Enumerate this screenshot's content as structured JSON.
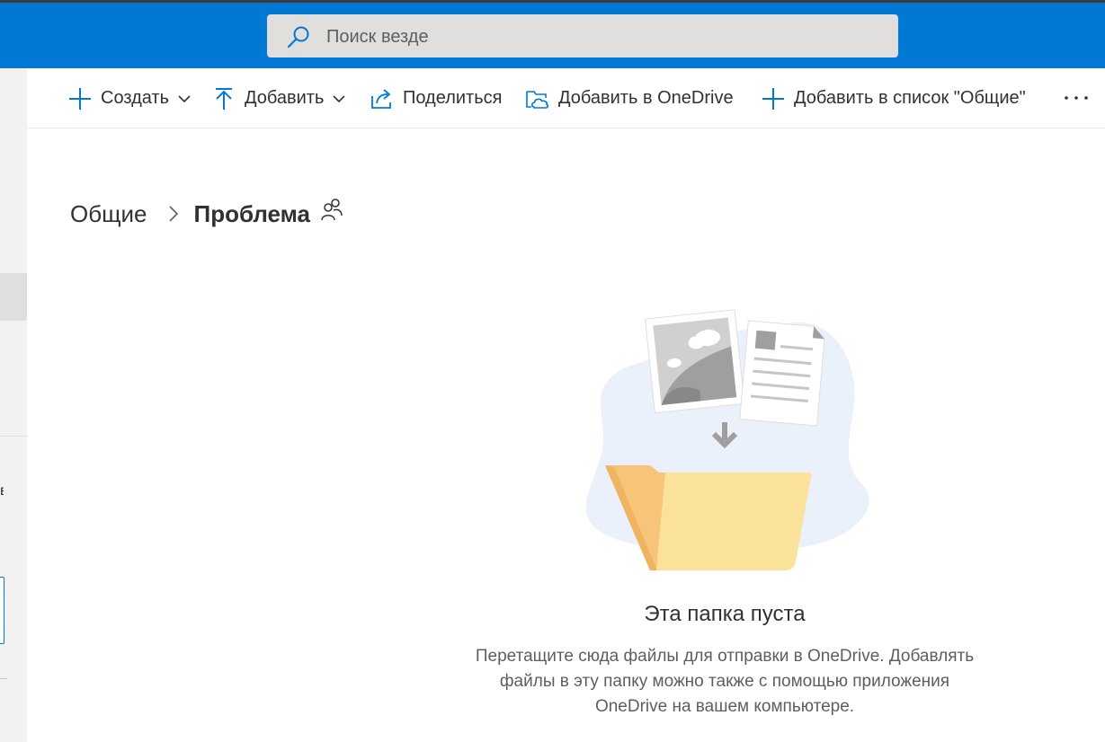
{
  "search": {
    "placeholder": "Поиск везде"
  },
  "toolbar": {
    "create_label": "Создать",
    "upload_label": "Добавить",
    "share_label": "Поделиться",
    "add_to_onedrive_label": "Добавить в OneDrive",
    "add_to_list_label": "Добавить в список \"Общие\""
  },
  "breadcrumb": {
    "root": "Общие",
    "current": "Проблема"
  },
  "empty_state": {
    "title": "Эта папка пуста",
    "description_line1": "Перетащите сюда файлы для отправки в OneDrive. Добавлять",
    "description_line2": "файлы в эту папку можно также с помощью приложения",
    "description_line3": "OneDrive на вашем компьютере."
  },
  "left_panel": {
    "fragment_text": "в"
  },
  "colors": {
    "accent": "#0078d4",
    "search_bg": "#e1dfdd",
    "text": "#323130",
    "secondary_text": "#605e5c"
  },
  "icons": [
    "search-icon",
    "plus-icon",
    "upload-icon",
    "share-icon",
    "onedrive-add-icon",
    "more-icon",
    "chevron-right-icon",
    "shared-people-icon"
  ]
}
